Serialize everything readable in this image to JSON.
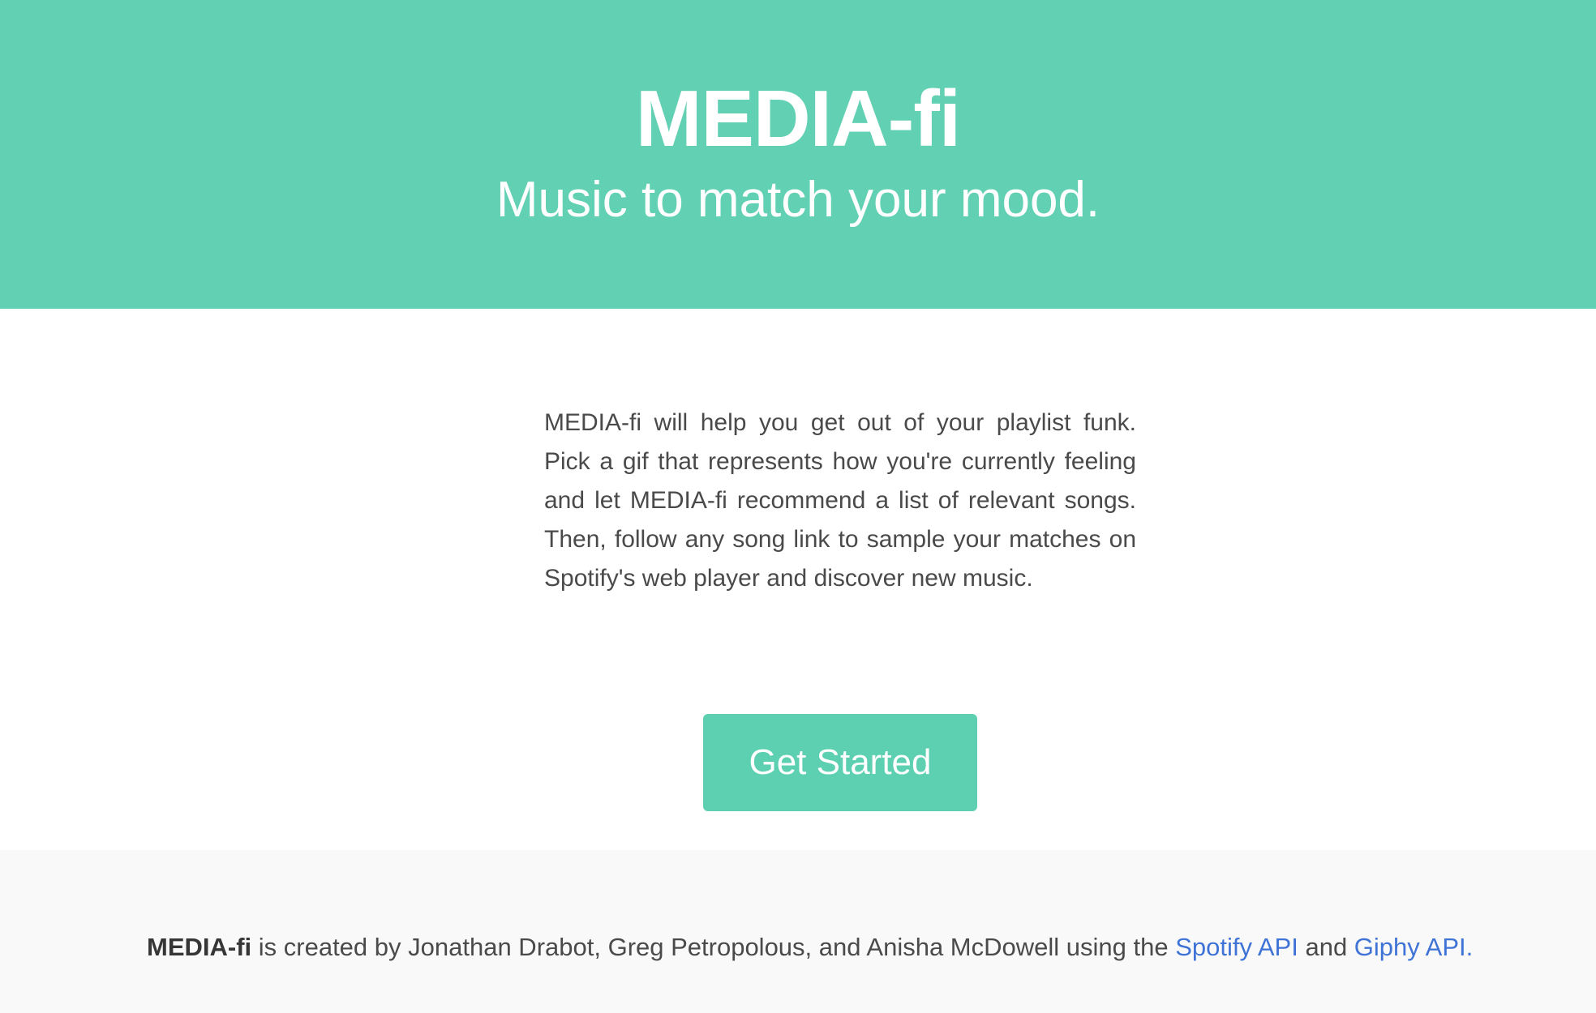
{
  "hero": {
    "title": "MEDIA-fi",
    "subtitle": "Music to match your mood."
  },
  "main": {
    "description": "MEDIA-fi will help you get out of your playlist funk. Pick a gif that represents how you're currently feeling and let MEDIA-fi recommend a list of relevant songs. Then, follow any song link to sample your matches on Spotify's web player and discover new music.",
    "cta_label": "Get Started"
  },
  "footer": {
    "brand": "MEDIA-fi",
    "text_middle": " is created by Jonathan Drabot, Greg Petropolous, and Anisha McDowell using the ",
    "spotify_link": "Spotify API",
    "and_text": " and ",
    "giphy_link": "Giphy API."
  },
  "colors": {
    "accent": "#62d0b3",
    "button": "#5cd0b1",
    "link": "#3f73d6",
    "footer_bg": "#f9f9f9"
  }
}
